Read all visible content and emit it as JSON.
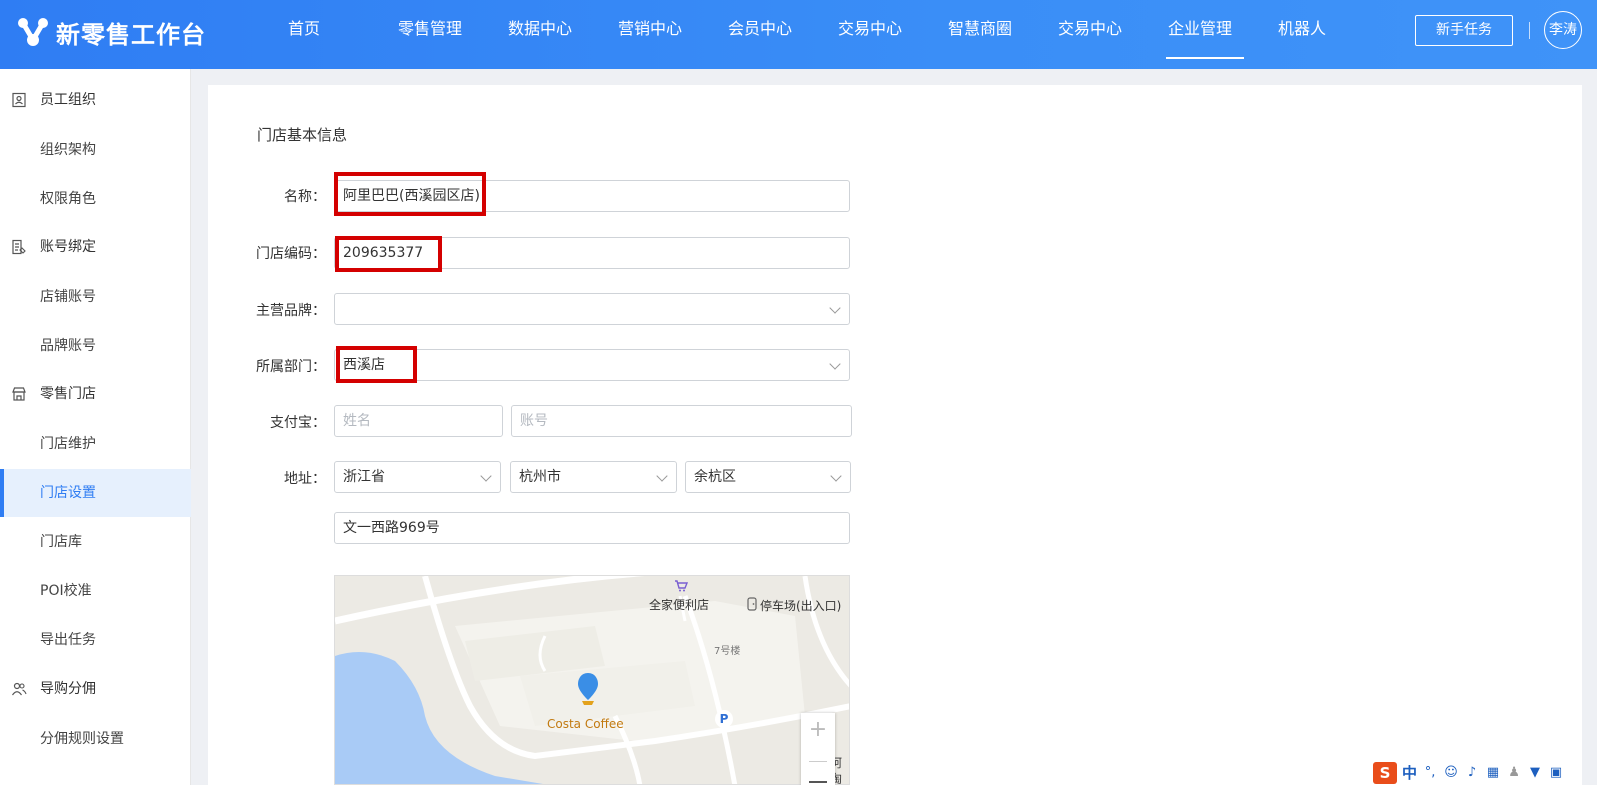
{
  "app": {
    "logo_text": "新零售工作台",
    "nav": [
      "首页",
      "零售管理",
      "数据中心",
      "营销中心",
      "会员中心",
      "交易中心",
      "智慧商圈",
      "交易中心",
      "企业管理",
      "机器人"
    ],
    "active_nav": "企业管理",
    "newbie_task": "新手任务",
    "user_name": "李涛"
  },
  "sidebar": {
    "groups": [
      {
        "label": "员工组织",
        "icon": "contact-card-icon",
        "items": [
          "组织架构",
          "权限角色"
        ]
      },
      {
        "label": "账号绑定",
        "icon": "account-bind-icon",
        "items": [
          "店铺账号",
          "品牌账号"
        ]
      },
      {
        "label": "零售门店",
        "icon": "store-icon",
        "items": [
          "门店维护",
          "门店设置",
          "门店库",
          "POI校准",
          "导出任务"
        ]
      },
      {
        "label": "导购分佣",
        "icon": "users-icon",
        "items": [
          "分佣规则设置"
        ]
      }
    ],
    "active_item": "门店设置"
  },
  "form": {
    "section_title": "门店基本信息",
    "name_label": "名称：",
    "name_value": "阿里巴巴(西溪园区店)",
    "code_label": "门店编码：",
    "code_value": "209635377",
    "brand_label": "主营品牌：",
    "brand_value": "",
    "dept_label": "所属部门：",
    "dept_value": "西溪店",
    "alipay_label": "支付宝：",
    "alipay_name_placeholder": "姓名",
    "alipay_account_placeholder": "账号",
    "address_label": "地址：",
    "province": "浙江省",
    "city": "杭州市",
    "district": "余杭区",
    "street": "文一西路969号"
  },
  "map": {
    "labels": {
      "convenience_store": "全家便利店",
      "parking": "停车场(出入口)",
      "building": "7号楼",
      "poi": "Costa Coffee",
      "parking_symbol": "P",
      "edge_text_1": "阿",
      "edge_text_2": "淘"
    },
    "zoom_in": "+",
    "colors": {
      "water": "#a9cbf6",
      "road": "#ffffff",
      "block": "#f4f3ee",
      "pin": "#3a8ee6",
      "poi_text": "#c27a10"
    }
  },
  "ime": {
    "logo": "S",
    "mode": "中"
  },
  "colors": {
    "brand": "#2f7df3",
    "highlight": "#d40000",
    "active_bg": "#e6f0fd"
  }
}
